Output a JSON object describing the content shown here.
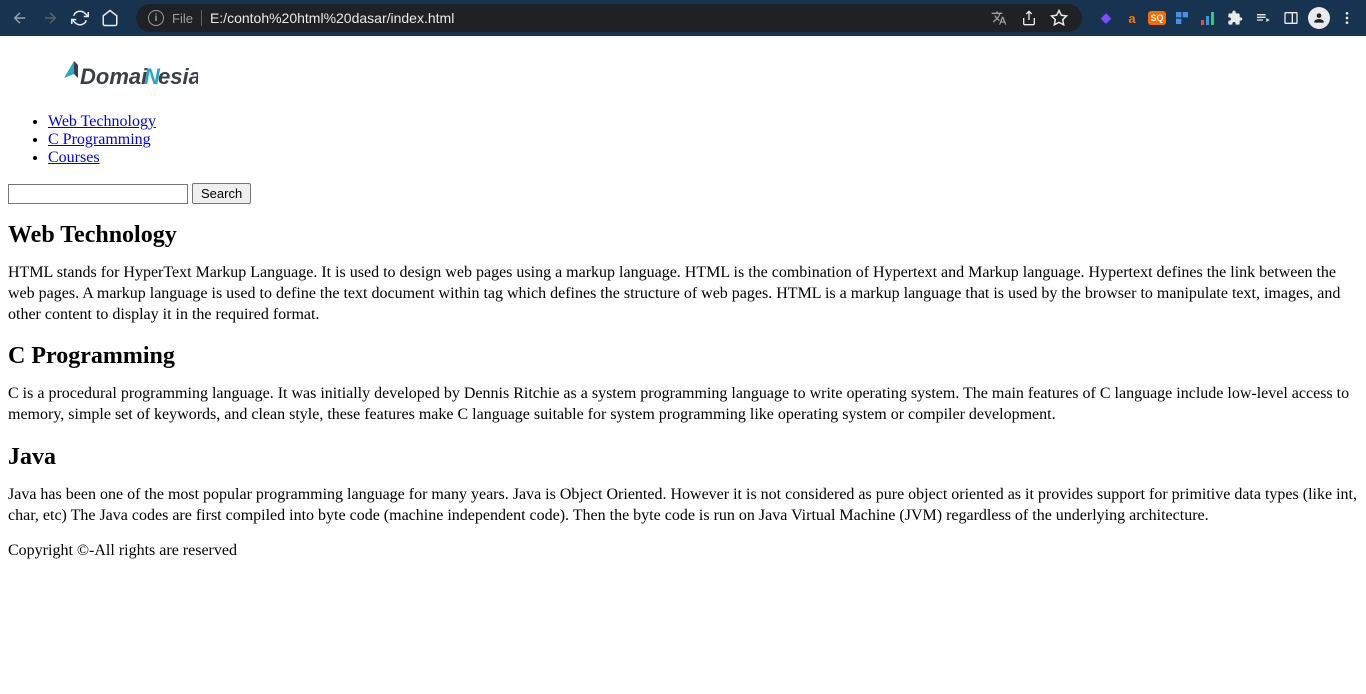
{
  "browser": {
    "url_scheme": "File",
    "url_path": "E:/contoh%20html%20dasar/index.html"
  },
  "logo": {
    "text_part1": "Domai",
    "text_part2": "Nesia"
  },
  "nav": {
    "items": [
      {
        "label": "Web Technology"
      },
      {
        "label": "C Programming"
      },
      {
        "label": "Courses"
      }
    ]
  },
  "search": {
    "button_label": "Search"
  },
  "sections": [
    {
      "heading": "Web Technology",
      "body": "HTML stands for HyperText Markup Language. It is used to design web pages using a markup language. HTML is the combination of Hypertext and Markup language. Hypertext defines the link between the web pages. A markup language is used to define the text document within tag which defines the structure of web pages. HTML is a markup language that is used by the browser to manipulate text, images, and other content to display it in the required format."
    },
    {
      "heading": "C Programming",
      "body": "C is a procedural programming language. It was initially developed by Dennis Ritchie as a system programming language to write operating system. The main features of C language include low-level access to memory, simple set of keywords, and clean style, these features make C language suitable for system programming like operating system or compiler development."
    },
    {
      "heading": "Java",
      "body": "Java has been one of the most popular programming language for many years. Java is Object Oriented. However it is not considered as pure object oriented as it provides support for primitive data types (like int, char, etc) The Java codes are first compiled into byte code (machine independent code). Then the byte code is run on Java Virtual Machine (JVM) regardless of the underlying architecture."
    }
  ],
  "footer": "Copyright ©-All rights are reserved"
}
